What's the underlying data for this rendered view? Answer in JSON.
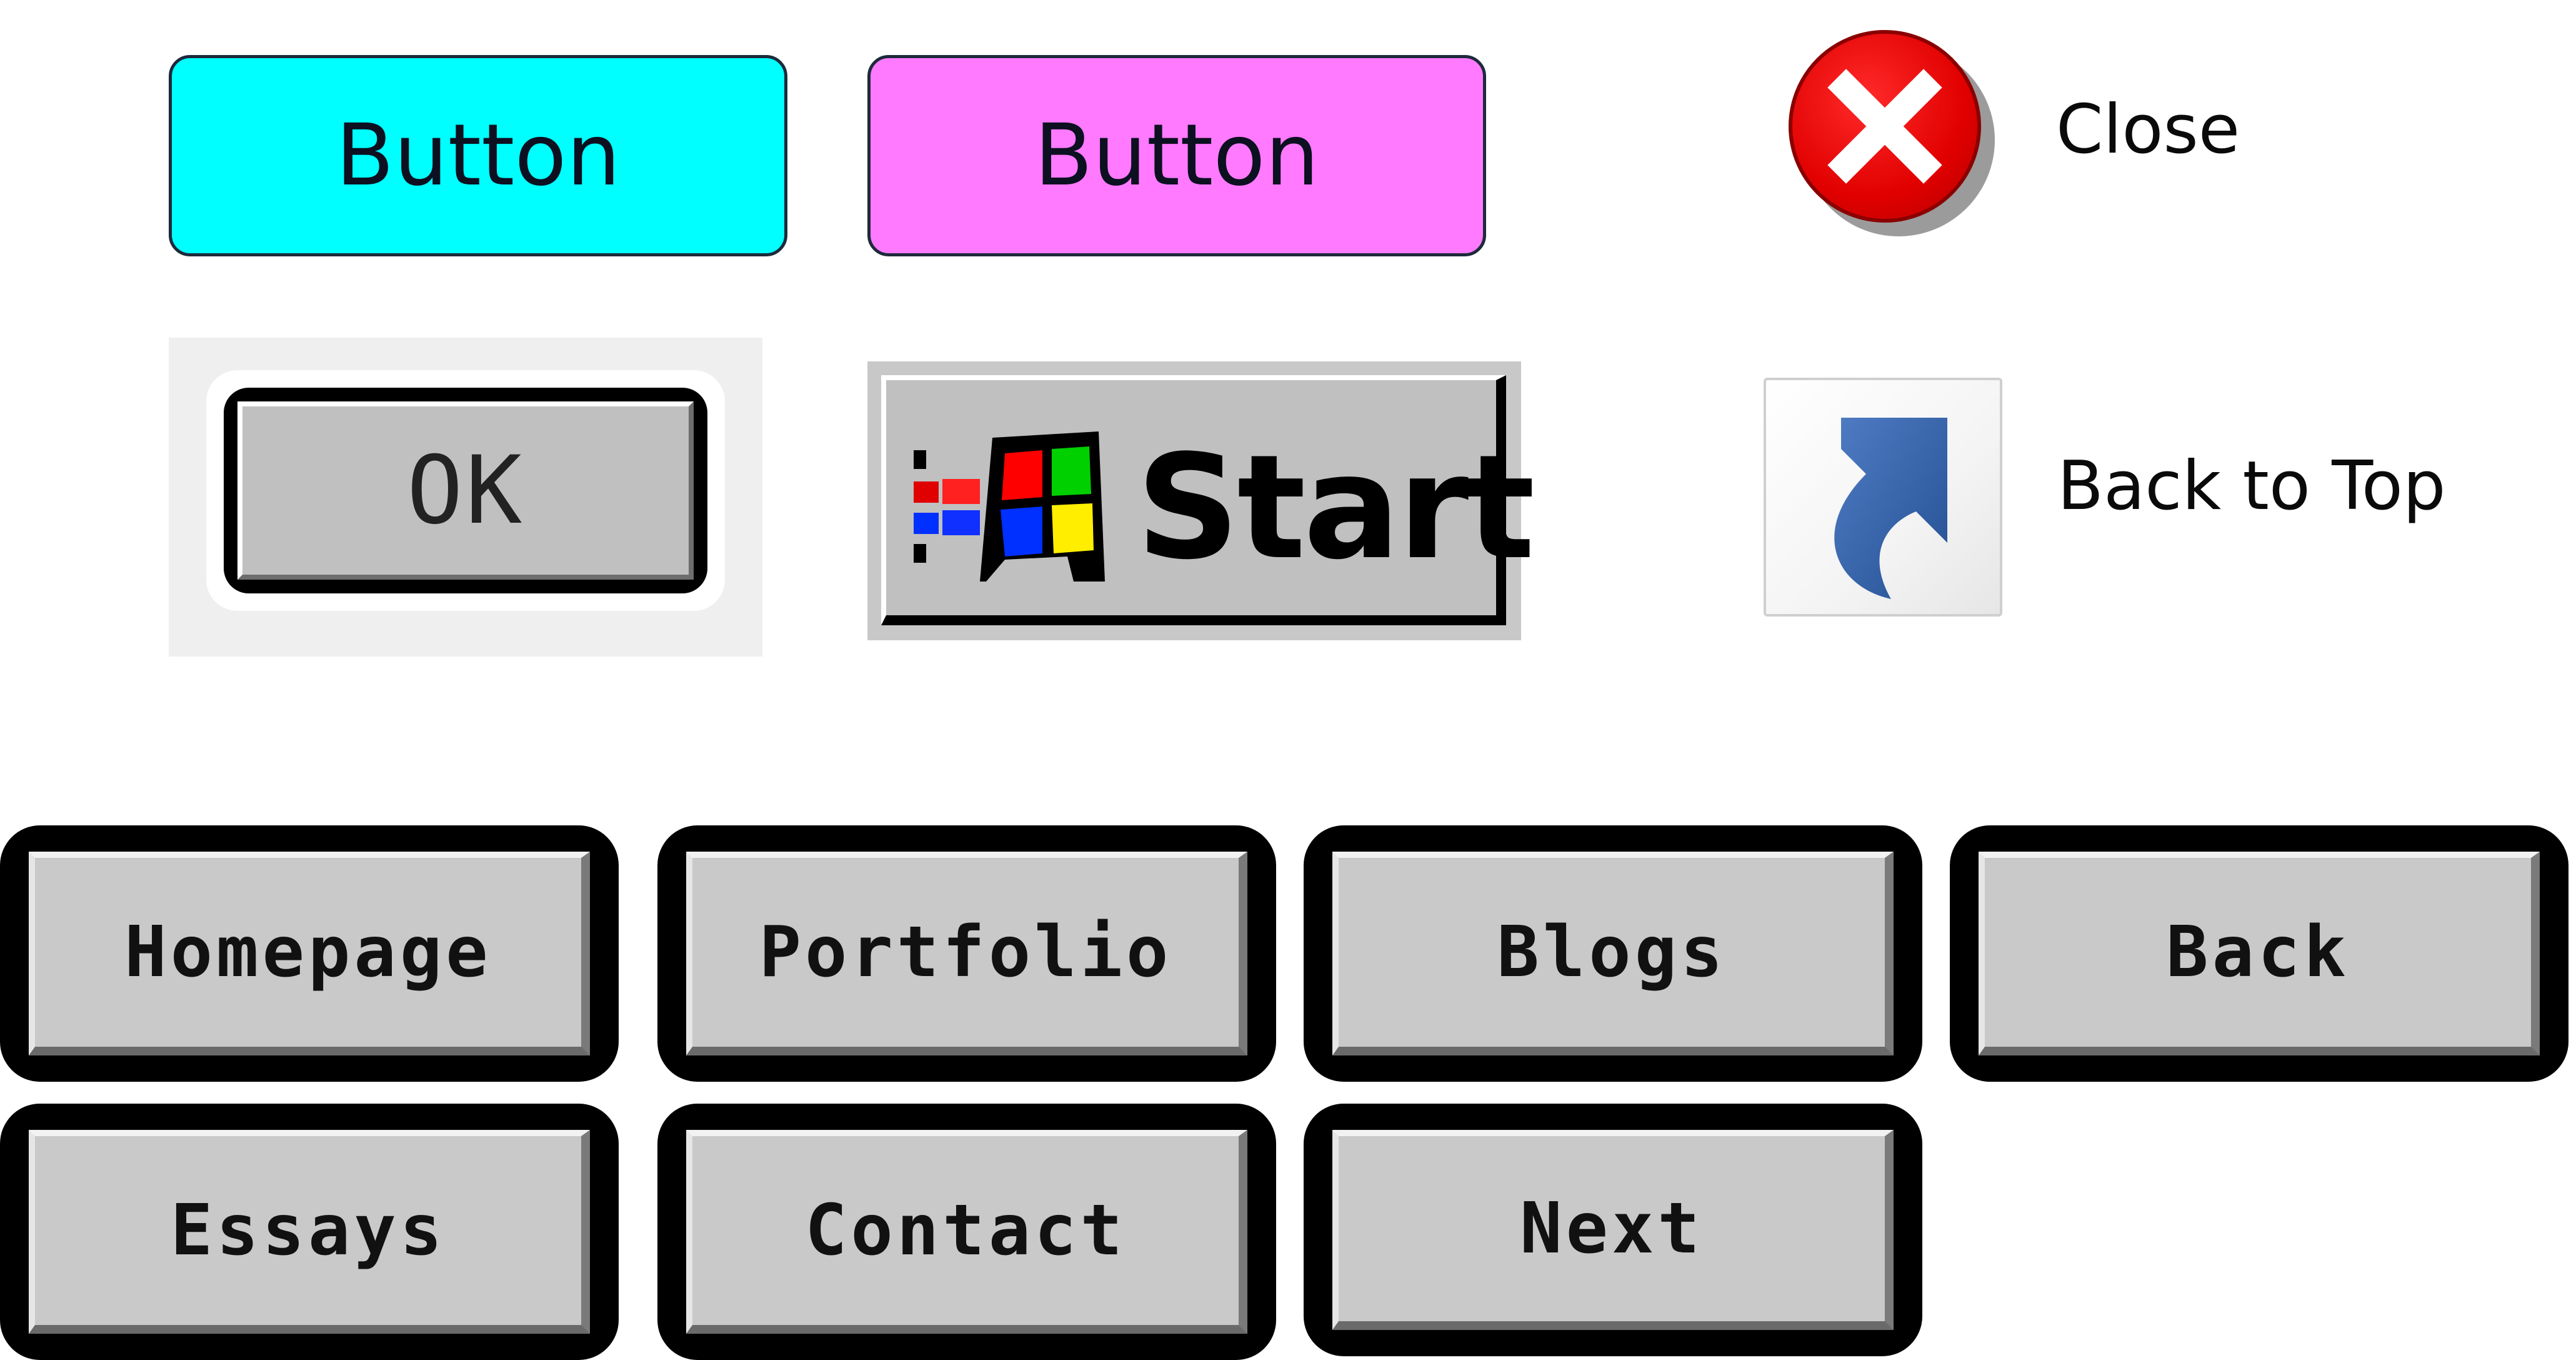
{
  "top_buttons": [
    {
      "label": "Button",
      "color": "#00ffff"
    },
    {
      "label": "Button",
      "color": "#ff7aff"
    }
  ],
  "close": {
    "icon": "close-icon",
    "label": "Close"
  },
  "ok_button": {
    "label": "OK"
  },
  "start_button": {
    "icon": "windows-logo-icon",
    "label": "Start"
  },
  "back_to_top": {
    "icon": "shortcut-arrow-icon",
    "label": "Back to Top"
  },
  "nav_buttons": [
    {
      "label": "Homepage"
    },
    {
      "label": "Portfolio"
    },
    {
      "label": "Blogs"
    },
    {
      "label": "Back"
    },
    {
      "label": "Essays"
    },
    {
      "label": "Contact"
    },
    {
      "label": "Next"
    }
  ]
}
